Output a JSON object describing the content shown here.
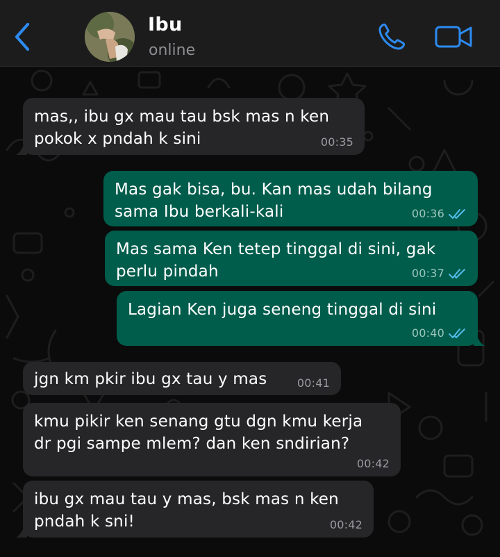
{
  "header": {
    "contact_name": "Ibu",
    "status": "online"
  },
  "colors": {
    "accent": "#2d8bf0",
    "incoming_bubble": "#262628",
    "outgoing_bubble": "#005c4b",
    "read_ticks": "#53bdeb"
  },
  "messages": [
    {
      "direction": "incoming",
      "text": "mas,, ibu gx mau tau bsk mas n ken\npokok x pndah k sini",
      "time": "00:35"
    },
    {
      "direction": "outgoing",
      "text": "Mas gak bisa, bu. Kan mas udah bilang\nsama Ibu berkali-kali",
      "time": "00:36",
      "status": "read"
    },
    {
      "direction": "outgoing",
      "text": "Mas sama Ken tetep tinggal di sini, gak\nperlu pindah",
      "time": "00:37",
      "status": "read"
    },
    {
      "direction": "outgoing",
      "text": "Lagian Ken juga seneng tinggal di sini",
      "time": "00:40",
      "status": "read"
    },
    {
      "direction": "incoming",
      "text": "jgn km pkir ibu gx tau y mas",
      "time": "00:41"
    },
    {
      "direction": "incoming",
      "text": "kmu pikir ken senang gtu dgn kmu kerja\ndr pgi sampe mlem? dan ken sndirian?",
      "time": "00:42"
    },
    {
      "direction": "incoming",
      "text": "ibu gx mau tau y mas, bsk mas n ken\npndah k sni!",
      "time": "00:42"
    }
  ]
}
